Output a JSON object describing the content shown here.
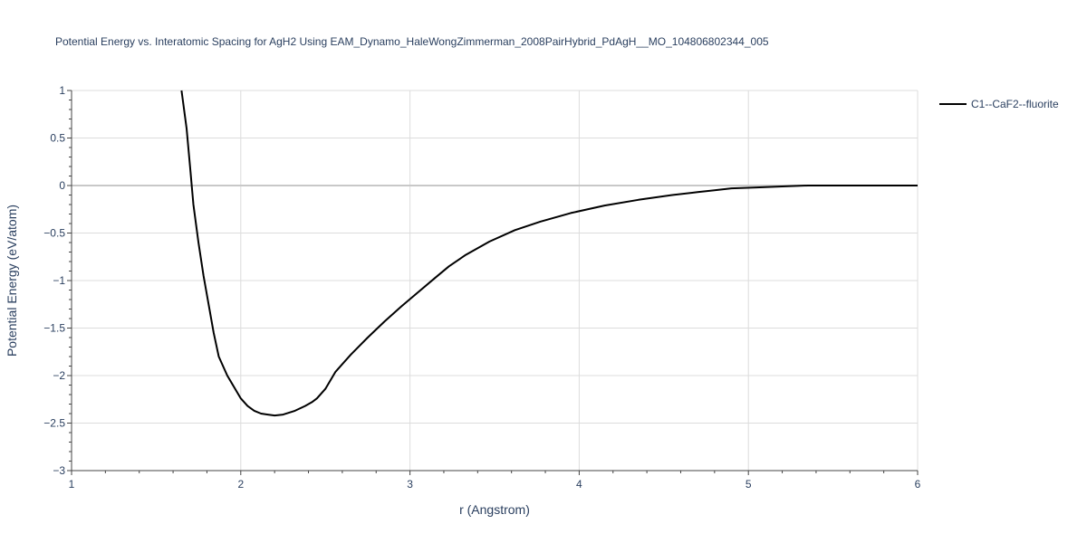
{
  "chart_data": {
    "type": "line",
    "title": "Potential Energy vs. Interatomic Spacing for AgH2 Using EAM_Dynamo_HaleWongZimmerman_2008PairHybrid_PdAgH__MO_104806802344_005",
    "xlabel": "r (Angstrom)",
    "ylabel": "Potential Energy (eV/atom)",
    "xlim": [
      1,
      6
    ],
    "ylim": [
      -3,
      1
    ],
    "x_ticks": [
      1,
      2,
      3,
      4,
      5,
      6
    ],
    "x_tick_labels": [
      "1",
      "2",
      "3",
      "4",
      "5",
      "6"
    ],
    "y_ticks": [
      1,
      0.5,
      0,
      -0.5,
      -1,
      -1.5,
      -2,
      -2.5,
      -3
    ],
    "y_tick_labels": [
      "1",
      "0.5",
      "0",
      "−0.5",
      "−1",
      "−1.5",
      "−2",
      "−2.5",
      "−3"
    ],
    "grid": true,
    "legend_position": "top-right",
    "line_color": "#000000",
    "series": [
      {
        "name": "C1--CaF2--fluorite",
        "x": [
          1.65,
          1.68,
          1.7,
          1.72,
          1.75,
          1.78,
          1.81,
          1.84,
          1.87,
          1.92,
          1.97,
          2.0,
          2.04,
          2.08,
          2.12,
          2.16,
          2.2,
          2.25,
          2.32,
          2.38,
          2.42,
          2.45,
          2.5,
          2.56,
          2.65,
          2.75,
          2.85,
          2.95,
          3.05,
          3.15,
          3.23,
          3.33,
          3.47,
          3.62,
          3.77,
          3.95,
          4.15,
          4.35,
          4.55,
          4.7,
          4.8,
          4.9,
          5.05,
          5.2,
          5.35,
          5.6,
          6.0
        ],
        "y": [
          1.0,
          0.6,
          0.2,
          -0.2,
          -0.6,
          -0.95,
          -1.25,
          -1.55,
          -1.8,
          -2.0,
          -2.15,
          -2.24,
          -2.32,
          -2.37,
          -2.4,
          -2.41,
          -2.42,
          -2.41,
          -2.37,
          -2.32,
          -2.28,
          -2.24,
          -2.14,
          -1.96,
          -1.78,
          -1.6,
          -1.43,
          -1.27,
          -1.12,
          -0.97,
          -0.85,
          -0.73,
          -0.59,
          -0.47,
          -0.38,
          -0.29,
          -0.21,
          -0.15,
          -0.1,
          -0.07,
          -0.05,
          -0.03,
          -0.02,
          -0.01,
          0.0,
          0.0,
          0.0
        ]
      }
    ]
  }
}
